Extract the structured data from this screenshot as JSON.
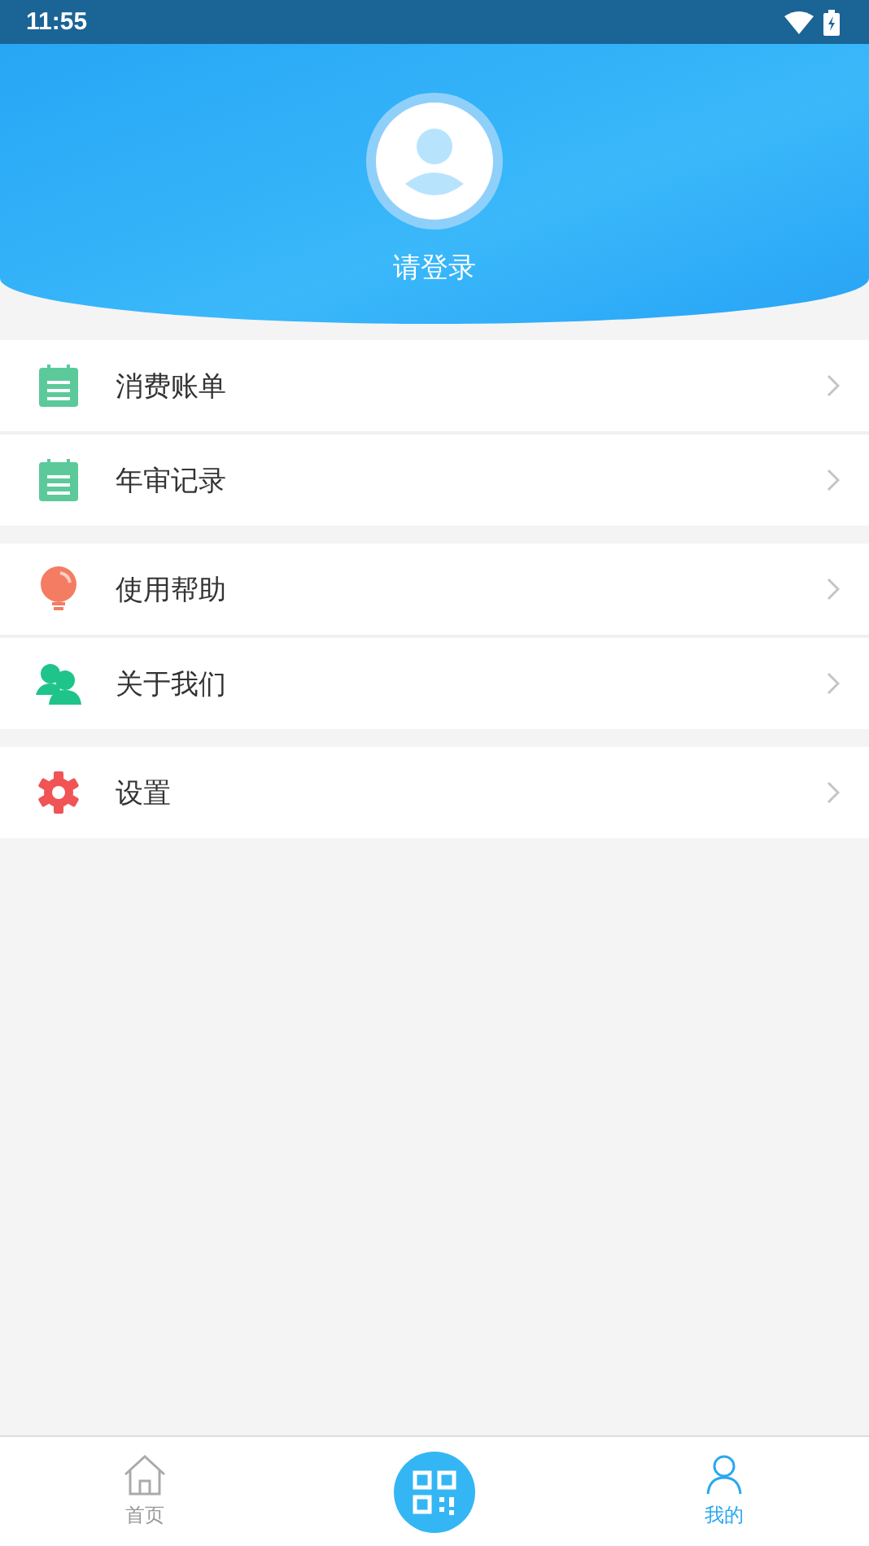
{
  "status_bar": {
    "time": "11:55"
  },
  "profile": {
    "login_prompt": "请登录"
  },
  "menu_groups": [
    [
      {
        "label": "消费账单",
        "kind": "bill"
      },
      {
        "label": "年审记录",
        "kind": "bill"
      }
    ],
    [
      {
        "label": "使用帮助",
        "kind": "help"
      },
      {
        "label": "关于我们",
        "kind": "about"
      }
    ],
    [
      {
        "label": "设置",
        "kind": "settings"
      }
    ]
  ],
  "bottom_nav": [
    {
      "kind": "home",
      "label": "首页",
      "selected": false
    },
    {
      "kind": "scan",
      "selected": false
    },
    {
      "kind": "profile",
      "label": "我的",
      "selected": true
    }
  ]
}
